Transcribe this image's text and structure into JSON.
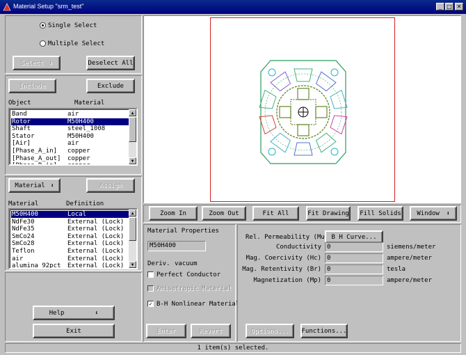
{
  "window": {
    "title": "Material Setup \"srm_test\"",
    "controls": {
      "minimize": "_",
      "maximize": "□",
      "close": "✕"
    }
  },
  "selection": {
    "single_label": "Single Select",
    "multiple_label": "Multiple Select",
    "selected_mode": "single",
    "select_button": "Select",
    "deselect_all_button": "Deselect All"
  },
  "objects": {
    "include_button": "Include",
    "exclude_button": "Exclude",
    "col_object": "Object",
    "col_material": "Material",
    "rows": [
      {
        "object": "Band",
        "material": "air",
        "selected": false
      },
      {
        "object": "Rotor",
        "material": "M50H400",
        "selected": true
      },
      {
        "object": "Shaft",
        "material": "steel_1008",
        "selected": false
      },
      {
        "object": "Stator",
        "material": "M50H400",
        "selected": false
      },
      {
        "object": "[Air]",
        "material": "air",
        "selected": false
      },
      {
        "object": "[Phase_A_in]",
        "material": "copper",
        "selected": false
      },
      {
        "object": "[Phase_A_out]",
        "material": "copper",
        "selected": false
      },
      {
        "object": "[Phase_B_in]",
        "material": "copper",
        "selected": false
      }
    ]
  },
  "materials": {
    "material_menu": "Material",
    "assign_button": "Assign",
    "col_material": "Material",
    "col_definition": "Definition",
    "rows": [
      {
        "material": "M50H400",
        "definition": "Local",
        "selected": true
      },
      {
        "material": "NdFe30",
        "definition": "External (Lock)",
        "selected": false
      },
      {
        "material": "NdFe35",
        "definition": "External (Lock)",
        "selected": false
      },
      {
        "material": "SmCo24",
        "definition": "External (Lock)",
        "selected": false
      },
      {
        "material": "SmCo28",
        "definition": "External (Lock)",
        "selected": false
      },
      {
        "material": "Teflon",
        "definition": "External (Lock)",
        "selected": false
      },
      {
        "material": "air",
        "definition": "External (Lock)",
        "selected": false
      },
      {
        "material": "alumina_92pct",
        "definition": "External (Lock)",
        "selected": false
      }
    ]
  },
  "footer_left": {
    "help_button": "Help",
    "exit_button": "Exit"
  },
  "view_toolbar": {
    "zoom_in": "Zoom In",
    "zoom_out": "Zoom Out",
    "fit_all": "Fit All",
    "fit_drawing": "Fit Drawing",
    "fill_solids": "Fill Solids",
    "window": "Window"
  },
  "properties": {
    "heading": "Material Properties",
    "name_value": "M50H400",
    "deriv_label": "Deriv.",
    "deriv_value": "vacuum",
    "perfect_conductor": {
      "label": "Perfect Conductor",
      "checked": false
    },
    "anisotropic": {
      "label": "Anisotropic Material",
      "checked": false
    },
    "bh_nonlinear": {
      "label": "B-H Nonlinear Material",
      "checked": true
    },
    "enter_button": "Enter",
    "revert_button": "Revert"
  },
  "params": {
    "rel_perm_label": "Rel. Permeability (Mu)",
    "bh_curve_button": "B H Curve...",
    "items": [
      {
        "label": "Conductivity",
        "value": "0",
        "unit": "siemens/meter"
      },
      {
        "label": "Mag. Coercivity (Hc)",
        "value": "0",
        "unit": "ampere/meter"
      },
      {
        "label": "Mag. Retentivity (Br)",
        "value": "0",
        "unit": "tesla"
      },
      {
        "label": "Magnetization (Mp)",
        "value": "0",
        "unit": "ampere/meter"
      }
    ],
    "options_button": "Options...",
    "functions_button": "Functions..."
  },
  "status_text": "1 item(s) selected.",
  "icons": {
    "dropdown": "dropdown-arrow-icon",
    "motor": "motor-geometry-icon",
    "app": "app-icon"
  }
}
